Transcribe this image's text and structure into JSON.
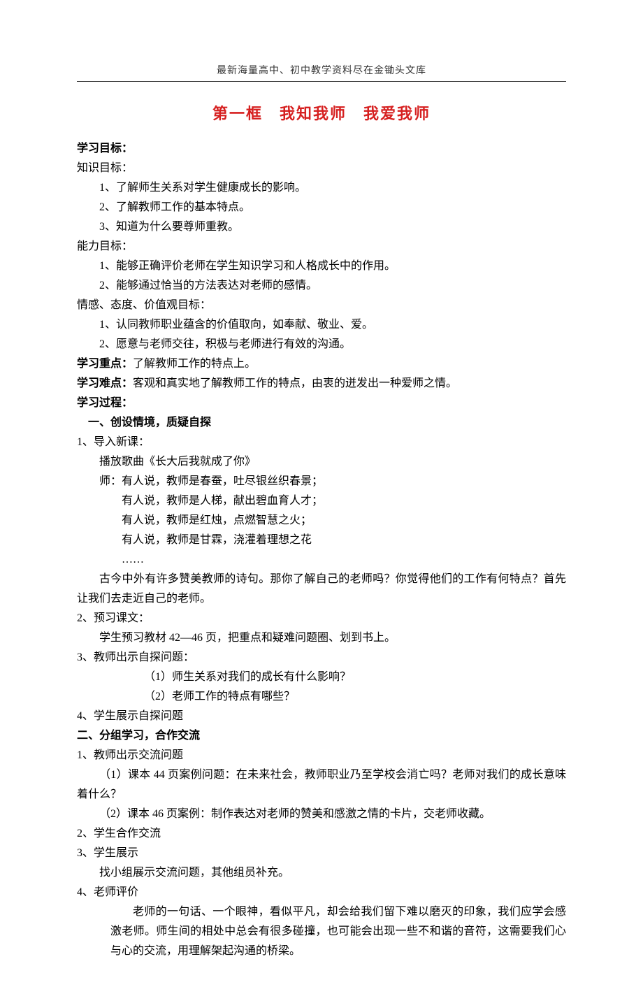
{
  "header": "最新海量高中、初中教学资料尽在金锄头文库",
  "title_part1": "第一框",
  "title_part2": "我知我师",
  "title_part3": "我爱我师",
  "l1": "学习目标：",
  "l2": "知识目标：",
  "l3": "1、了解师生关系对学生健康成长的影响。",
  "l4": "2、了解教师工作的基本特点。",
  "l5": "3、知道为什么要尊师重教。",
  "l6": "能力目标：",
  "l7": "1、能够正确评价老师在学生知识学习和人格成长中的作用。",
  "l8": "2、能够通过恰当的方法表达对老师的感情。",
  "l9": "情感、态度、价值观目标：",
  "l10": "1、认同教师职业蕴含的价值取向，如奉献、敬业、爱。",
  "l11": "2、愿意与老师交往，积极与老师进行有效的沟通。",
  "l12a": "学习重点：",
  "l12b": "了解教师工作的特点上。",
  "l13a": "学习难点：",
  "l13b": "客观和真实地了解教师工作的特点，由衷的迸发出一种爱师之情。",
  "l14": "学习过程：",
  "l15": "一、创设情境，质疑自探",
  "l16": "1、导入新课：",
  "l17": "播放歌曲《长大后我就成了你》",
  "l18": "师：有人说，教师是春蚕，吐尽银丝织春景；",
  "l19": "有人说，教师是人梯，献出碧血育人才；",
  "l20": "有人说，教师是红烛，点燃智慧之火；",
  "l21": "有人说，教师是甘霖，浇灌着理想之花",
  "l22": "……",
  "l23": "古今中外有许多赞美教师的诗句。那你了解自己的老师吗？你觉得他们的工作有何特点？首先让我们去走近自己的老师。",
  "l24": "2、预习课文：",
  "l25": "学生预习教材 42—46 页，把重点和疑难问题圈、划到书上。",
  "l26": "3、教师出示自探问题：",
  "l27": "（1）师生关系对我们的成长有什么影响？",
  "l28": "（2）老师工作的特点有哪些？",
  "l29": "4、学生展示自探问题",
  "l30": "二、分组学习，合作交流",
  "l31": "1、教师出示交流问题",
  "l32": "（1）课本 44 页案例问题：在未来社会，教师职业乃至学校会消亡吗？老师对我们的成长意味着什么？",
  "l33": "（2）课本 46 页案例：制作表达对老师的赞美和感激之情的卡片，交老师收藏。",
  "l34": "2、学生合作交流",
  "l35": "3、学生展示",
  "l36": "找小组展示交流问题，其他组员补充。",
  "l37": "4、老师评价",
  "l38": "老师的一句话、一个眼神，看似平凡，却会给我们留下难以磨灭的印象，我们应学会感激老师。师生间的相处中总会有很多碰撞，也可能会出现一些不和谐的音符，这需要我们心与心的交流，用理解架起沟通的桥梁。"
}
